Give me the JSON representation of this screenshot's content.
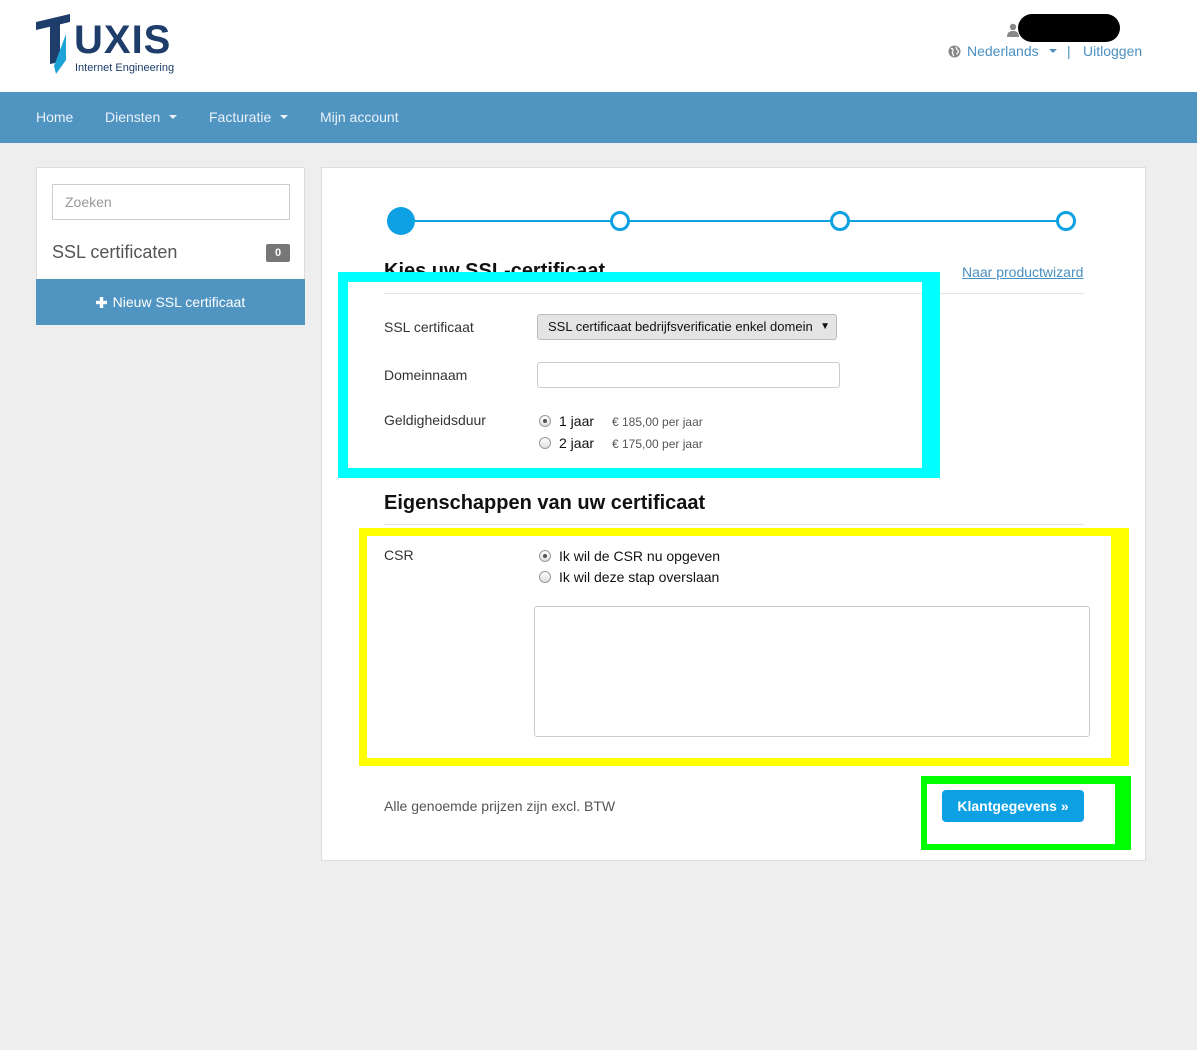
{
  "header": {
    "logo_word": "UXIS",
    "logo_subtitle": "Internet Engineering",
    "language": "Nederlands",
    "separator": "|",
    "logout": "Uitloggen"
  },
  "nav": {
    "items": [
      {
        "label": "Home",
        "dropdown": false
      },
      {
        "label": "Diensten",
        "dropdown": true
      },
      {
        "label": "Facturatie",
        "dropdown": true
      },
      {
        "label": "Mijn account",
        "dropdown": false
      }
    ]
  },
  "sidebar": {
    "search_placeholder": "Zoeken",
    "title": "SSL certificaten",
    "count": "0",
    "new_button": "Nieuw SSL certificaat"
  },
  "wizard": {
    "steps_total": 4,
    "current_step": 1,
    "section1_title": "Kies uw SSL-certificaat",
    "product_link": "Naar productwizard",
    "ssl_label": "SSL certificaat",
    "ssl_selected": "SSL certificaat bedrijfsverificatie enkel domein",
    "domain_label": "Domeinnaam",
    "domain_value": "",
    "validity_label": "Geldigheidsduur",
    "validity_options": [
      {
        "label": "1 jaar",
        "price": "€ 185,00 per jaar",
        "checked": true
      },
      {
        "label": "2 jaar",
        "price": "€ 175,00 per jaar",
        "checked": false
      }
    ],
    "section2_title": "Eigenschappen van uw certificaat",
    "csr_label": "CSR",
    "csr_options": [
      {
        "label": "Ik wil de CSR nu opgeven",
        "checked": true
      },
      {
        "label": "Ik wil deze stap overslaan",
        "checked": false
      }
    ],
    "csr_value": "",
    "footnote": "Alle genoemde prijzen zijn excl. BTW",
    "next_button": "Klantgegevens »"
  },
  "colors": {
    "brand_nav": "#5094c1",
    "accent": "#0da1e3",
    "link": "#4a90c2",
    "highlight_cyan": "#00ffff",
    "highlight_yellow": "#ffff00",
    "highlight_green": "#00ff00"
  }
}
